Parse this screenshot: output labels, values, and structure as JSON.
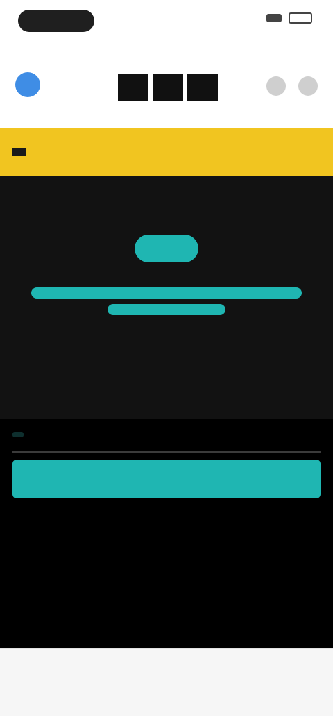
{
  "status": {},
  "nav": {},
  "banner": {},
  "match": {},
  "article": {}
}
